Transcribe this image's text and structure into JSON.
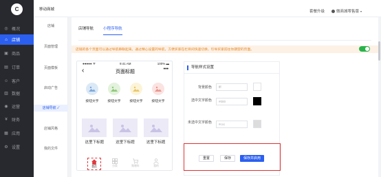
{
  "app": {
    "logo_text": "C",
    "header_title": "移动商城",
    "upgrade_label": "套餐升级",
    "account_label": "微商城零售版"
  },
  "sidebar": {
    "items": [
      {
        "label": "概况",
        "icon": "home-icon"
      },
      {
        "label": "店铺",
        "icon": "shop-icon",
        "active": true
      },
      {
        "label": "商品",
        "icon": "goods-icon"
      },
      {
        "label": "订单",
        "icon": "order-icon"
      },
      {
        "label": "客户",
        "icon": "customer-icon"
      },
      {
        "label": "数据",
        "icon": "data-icon"
      },
      {
        "label": "运营",
        "icon": "operation-icon"
      },
      {
        "label": "财务",
        "icon": "finance-icon"
      },
      {
        "label": "应用",
        "icon": "apps-icon"
      },
      {
        "label": "设置",
        "icon": "settings-icon"
      }
    ]
  },
  "subnav": {
    "items": [
      {
        "label": "店铺"
      },
      {
        "label": "页面管理"
      },
      {
        "label": "页面模板"
      },
      {
        "label": "启动广告"
      },
      {
        "label": "店铺导航 ✓",
        "active": true
      },
      {
        "label": "店铺风格"
      },
      {
        "label": "我的文件"
      }
    ]
  },
  "main": {
    "tabs": [
      {
        "label": "店铺导航"
      },
      {
        "label": "小程序导航",
        "active": true
      }
    ],
    "notice": "店铺的各个页面可以通过导航串联起来。通过精心设置的导航，方便买家在栏目间快速切换，引导买家前往你期望的页面。",
    "toggle_on": true
  },
  "phone": {
    "status_left": "●●●●● ᯤ",
    "status_time": "9:41 AM",
    "status_battery": "100% ▬",
    "back_glyph": "‹",
    "page_title": "页面标题",
    "more_glyph": "•••",
    "icon_items": [
      {
        "label": "按钮文字",
        "color": "#dbe9f7"
      },
      {
        "label": "按钮文字",
        "color": "#e3f2dc"
      },
      {
        "label": "按钮文字",
        "color": "#fcf4d8"
      },
      {
        "label": "按钮文字",
        "color": "#fbe3e1"
      }
    ],
    "image_items": [
      {
        "label": "这里下标题"
      },
      {
        "label": "这里下标题"
      },
      {
        "label": "这里下标题"
      }
    ],
    "tabbar": [
      {
        "label": "首页",
        "active": true
      },
      {
        "label": "分类"
      },
      {
        "label": "购物车"
      },
      {
        "label": "我的"
      }
    ]
  },
  "panel": {
    "title": "导航样式设置",
    "rows": [
      {
        "label": "背景颜色",
        "value": "fff",
        "swatch": "#ffffff"
      },
      {
        "label": "选中文字颜色",
        "value": "#000",
        "swatch": "#000000"
      },
      {
        "label": "未选中文字颜色",
        "value": "#ccc",
        "swatch": "#dcdcdc"
      }
    ]
  },
  "actions": {
    "reset_label": "重置",
    "save_label": "保存",
    "save_publish_label": "保存并启用"
  },
  "colors": {
    "accent": "#2b5ff0",
    "sidebar_bg": "#28292f",
    "notice_bg": "#fdf1e5",
    "notice_text": "#e58a2a",
    "toggle_on": "#28b34a",
    "highlight_border": "#e03131"
  }
}
